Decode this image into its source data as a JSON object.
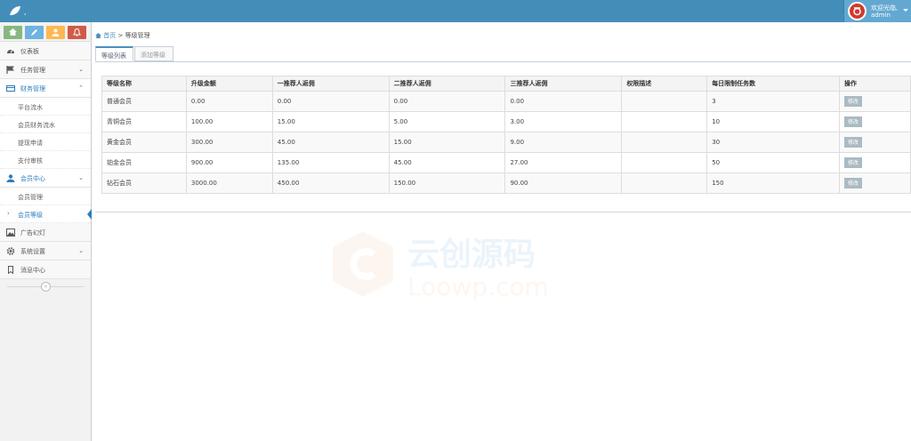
{
  "topbar": {
    "user_welcome": "欢迎光临,",
    "user_name": "admin"
  },
  "sidebar": {
    "shortcuts": [
      {
        "icon": "home-icon",
        "color": "#87b87f"
      },
      {
        "icon": "pencil-icon",
        "color": "#6fb3e0"
      },
      {
        "icon": "users-icon",
        "color": "#ffb752"
      },
      {
        "icon": "bell-icon",
        "color": "#d15b47"
      }
    ],
    "items": [
      {
        "label": "仪表板",
        "icon": "dashboard-icon"
      },
      {
        "label": "任务管理",
        "icon": "flag-icon"
      },
      {
        "label": "财务管理",
        "icon": "card-icon"
      },
      {
        "label": "平台流水"
      },
      {
        "label": "会员财务流水"
      },
      {
        "label": "提现申请"
      },
      {
        "label": "支付审核"
      },
      {
        "label": "会员中心",
        "icon": "user-icon"
      },
      {
        "label": "会员管理"
      },
      {
        "label": "会员等级"
      },
      {
        "label": "广告幻灯",
        "icon": "picture-icon"
      },
      {
        "label": "系统设置",
        "icon": "gear-icon"
      },
      {
        "label": "消息中心",
        "icon": "bookmark-icon"
      }
    ]
  },
  "breadcrumb": {
    "home": "首页",
    "separator": ">",
    "current": "等级管理"
  },
  "tabs": [
    "等级列表",
    "添加等级"
  ],
  "table": {
    "headers": [
      "等级名称",
      "升级金额",
      "一推荐人返佣",
      "二推荐人返佣",
      "三推荐人返佣",
      "权限描述",
      "每日限制任务数",
      "操作"
    ],
    "rows": [
      [
        "普通会员",
        "0.00",
        "0.00",
        "0.00",
        "0.00",
        "",
        "3"
      ],
      [
        "青铜会员",
        "100.00",
        "15.00",
        "5.00",
        "3.00",
        "",
        "10"
      ],
      [
        "黄金会员",
        "300.00",
        "45.00",
        "15.00",
        "9.00",
        "",
        "30"
      ],
      [
        "铂金会员",
        "900.00",
        "135.00",
        "45.00",
        "27.00",
        "",
        "50"
      ],
      [
        "钻石会员",
        "3000.00",
        "450.00",
        "150.00",
        "90.00",
        "",
        "150"
      ]
    ],
    "edit_label": "修改"
  },
  "watermark": {
    "title": "云创源码",
    "subtitle": "Loowp.com"
  }
}
